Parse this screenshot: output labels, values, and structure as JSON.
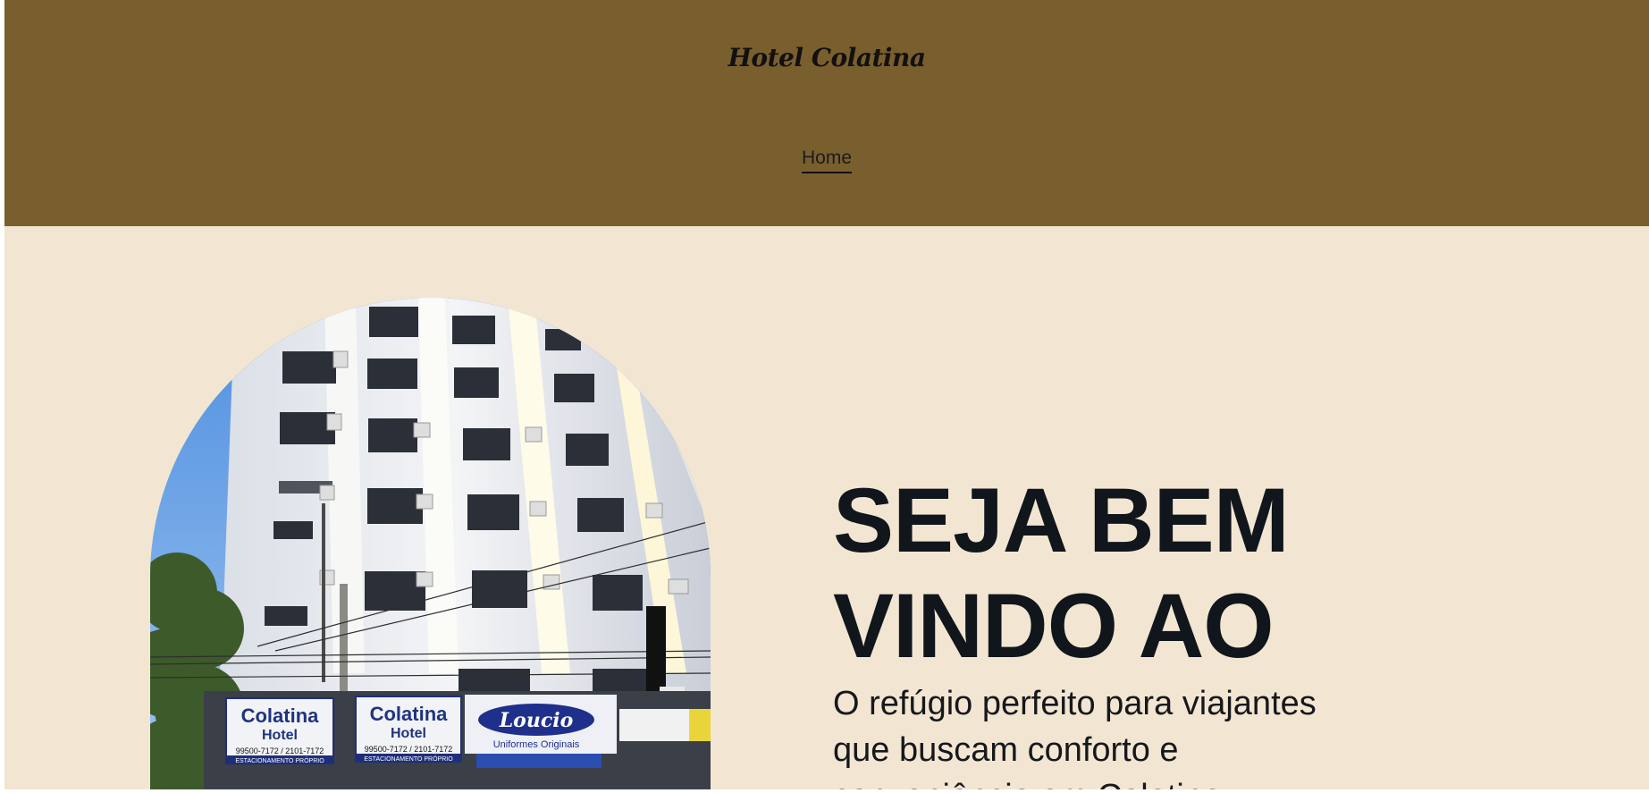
{
  "header": {
    "site_title": "Hotel Colatina",
    "nav": [
      {
        "label": "Home"
      }
    ],
    "background_color": "#7a5f2e"
  },
  "hero": {
    "heading_line1": "SEJA BEM",
    "heading_line2": "VINDO AO",
    "subtitle": "O refúgio perfeito para viajantes que buscam conforto e conveniência em Colatina.",
    "image": {
      "signs": [
        {
          "name": "Colatina",
          "sub": "Hotel",
          "phone": "99500-7172 / 2101-7172",
          "note": "ESTACIONAMENTO PRÓPRIO"
        },
        {
          "name": "Colatina",
          "sub": "Hotel",
          "phone": "99500-7172 / 2101-7172",
          "note": "ESTACIONAMENTO PRÓPRIO"
        },
        {
          "name": "Loucio",
          "sub": "Uniformes Originais"
        }
      ]
    }
  },
  "colors": {
    "page_background": "#f2e6d3",
    "heading_text": "#10161b"
  }
}
